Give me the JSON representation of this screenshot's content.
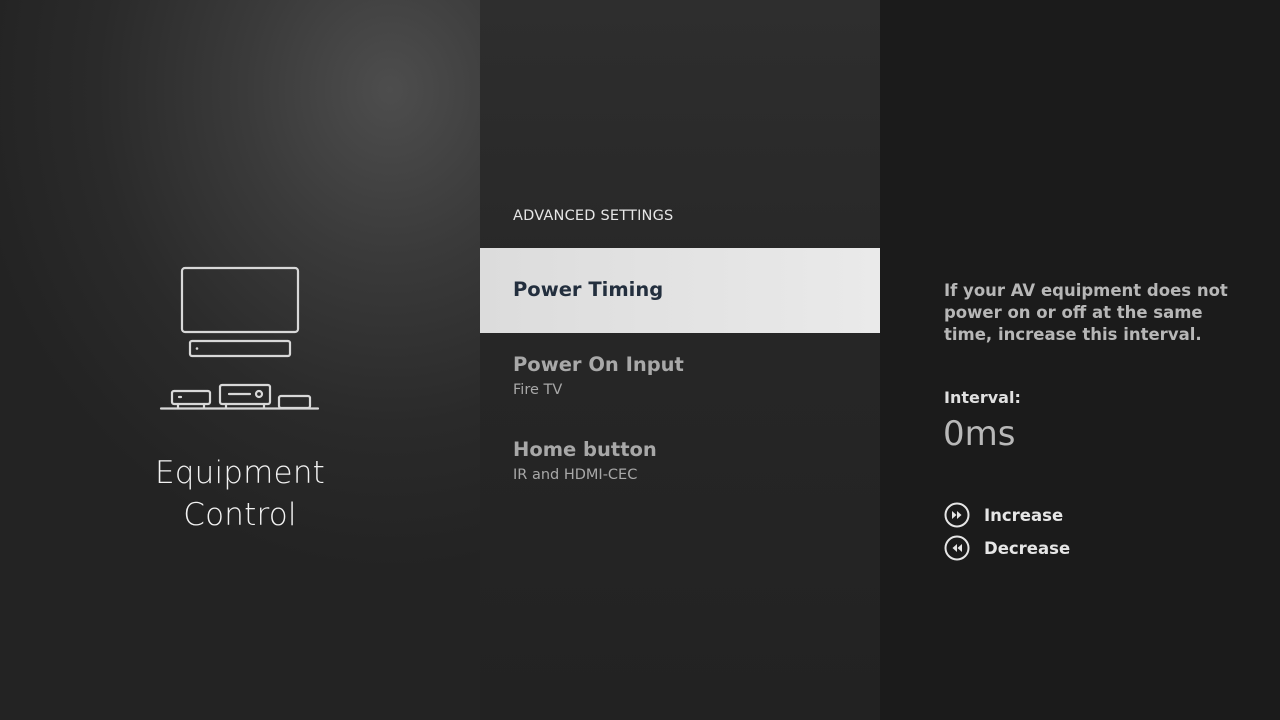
{
  "left_panel": {
    "illustration_icon": "av-equipment-icon",
    "title_line1": "Equipment",
    "title_line2": "Control"
  },
  "menu": {
    "header": "ADVANCED SETTINGS",
    "items": [
      {
        "label": "Power Timing",
        "sublabel": "",
        "selected": true
      },
      {
        "label": "Power On Input",
        "sublabel": "Fire TV",
        "selected": false
      },
      {
        "label": "Home button",
        "sublabel": "IR and HDMI-CEC",
        "selected": false
      }
    ]
  },
  "detail": {
    "description": "If your AV equipment does not power on or off at the same time, increase this interval.",
    "interval_label": "Interval:",
    "interval_value": "0ms",
    "controls": [
      {
        "icon": "fast-forward-icon",
        "label": "Increase"
      },
      {
        "icon": "rewind-icon",
        "label": "Decrease"
      }
    ]
  },
  "colors": {
    "selected_bg": "#e6e6e6",
    "selected_text": "#232f3e",
    "muted_text": "#a8a8a8",
    "right_bg": "#1b1b1b"
  }
}
